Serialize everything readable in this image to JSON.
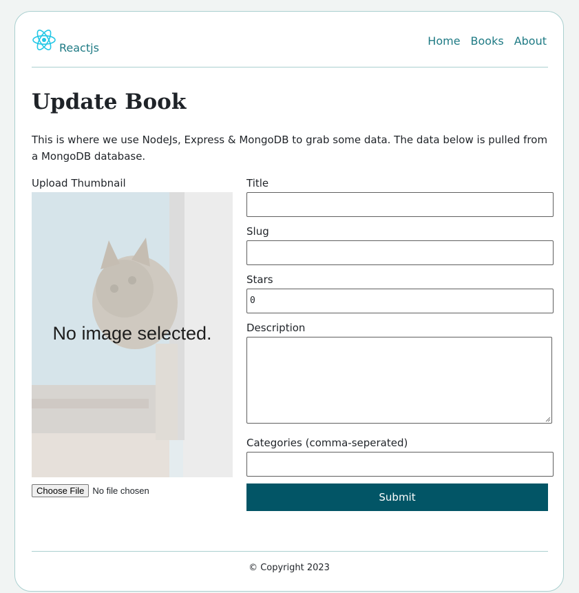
{
  "brand": {
    "name": "Reactjs",
    "logo_icon": "react-atom-icon",
    "accent_color": "#1e7a84"
  },
  "nav": {
    "items": [
      "Home",
      "Books",
      "About"
    ]
  },
  "page": {
    "title": "Update Book",
    "intro": "This is where we use NodeJs, Express & MongoDB to grab some data. The data below is pulled from a MongoDB database."
  },
  "thumbnail": {
    "label": "Upload Thumbnail",
    "placeholder_text": "No image selected.",
    "choose_file_label": "Choose File",
    "file_status": "No file chosen"
  },
  "form": {
    "title": {
      "label": "Title",
      "value": ""
    },
    "slug": {
      "label": "Slug",
      "value": ""
    },
    "stars": {
      "label": "Stars",
      "value": "0"
    },
    "description": {
      "label": "Description",
      "value": ""
    },
    "categories": {
      "label": "Categories (comma-seperated)",
      "value": ""
    },
    "submit_label": "Submit",
    "submit_color": "#025566"
  },
  "footer": {
    "text": "© Copyright 2023"
  }
}
